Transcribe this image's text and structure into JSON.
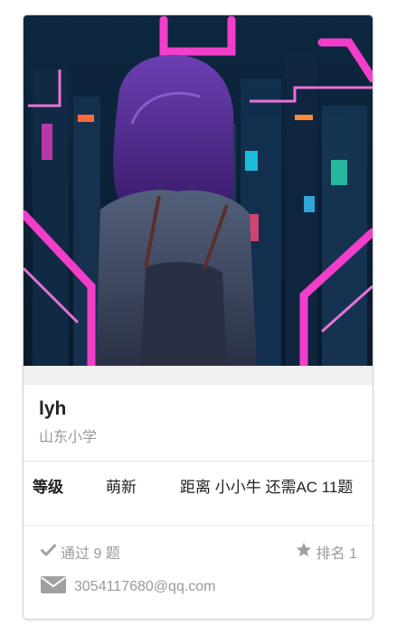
{
  "user": {
    "name": "lyh",
    "school": "山东小学"
  },
  "level": {
    "label": "等级",
    "value": "萌新",
    "next": "距离 小小牛 还需AC 11题"
  },
  "stats": {
    "solved": "通过 9 题",
    "rank": "排名 1",
    "email": "3054117680@qq.com"
  },
  "icons": {
    "solved": "check-icon",
    "rank": "star-icon",
    "email": "envelope-icon"
  },
  "colors": {
    "muted_text": "#9a9a9a",
    "neon_pink": "#ff3fd2",
    "neon_blue": "#2fd0ff"
  }
}
